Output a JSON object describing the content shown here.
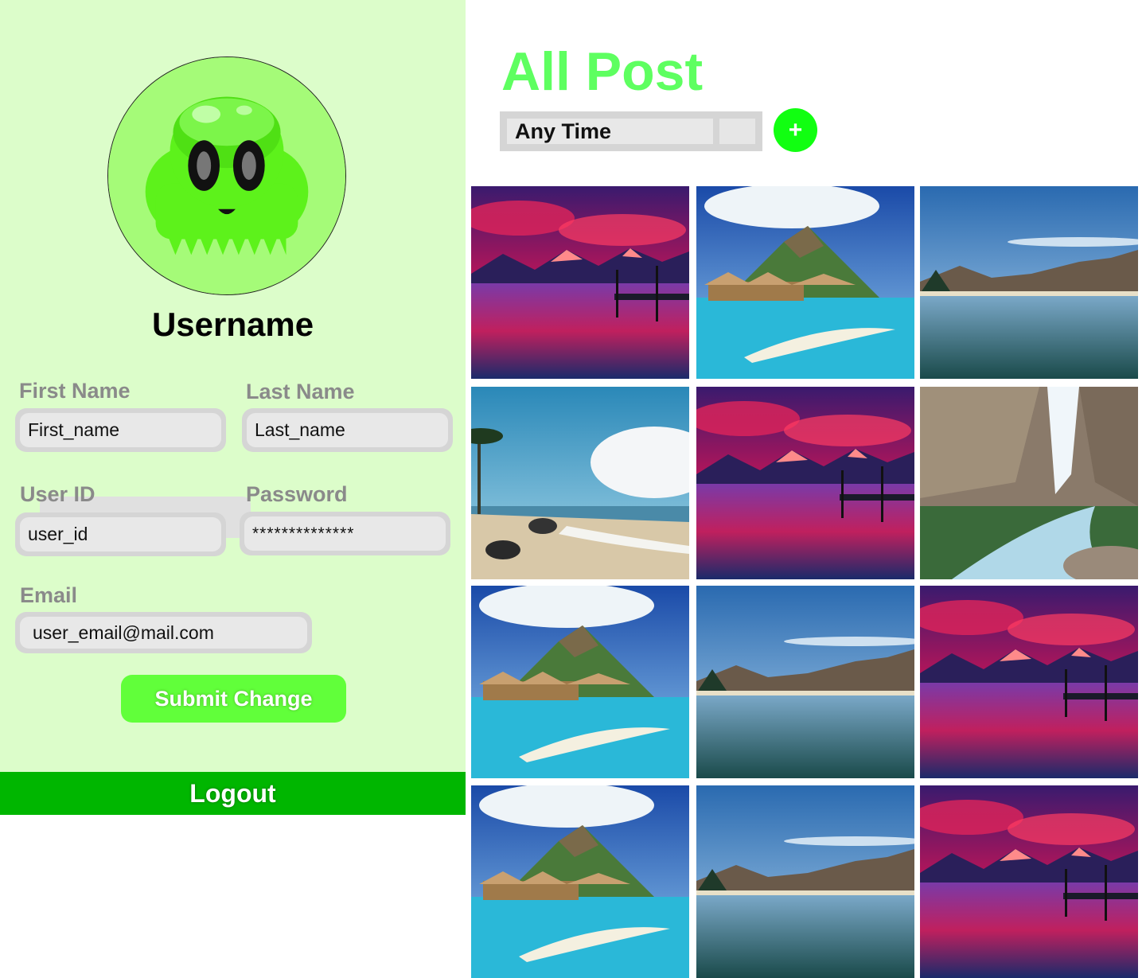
{
  "profile": {
    "username": "Username",
    "avatar_icon": "green-slime-alien-icon",
    "fields": {
      "first_name": {
        "label": "First Name",
        "value": "First_name"
      },
      "last_name": {
        "label": "Last Name",
        "value": "Last_name"
      },
      "user_id": {
        "label": "User ID",
        "value": "user_id"
      },
      "password": {
        "label": "Password",
        "value": "**************"
      },
      "email": {
        "label": "Email",
        "value": "user_email@mail.com"
      }
    },
    "submit_label": "Submit Change",
    "logout_label": "Logout"
  },
  "posts_section": {
    "title": "All Post",
    "time_filter": {
      "selected": "Any Time"
    },
    "add_button_label": "+"
  },
  "posts": [
    {
      "scene": "sunset-lake"
    },
    {
      "scene": "tropical-island"
    },
    {
      "scene": "mountain-lake"
    },
    {
      "scene": "beach"
    },
    {
      "scene": "sunset-lake"
    },
    {
      "scene": "waterfall"
    },
    {
      "scene": "tropical-island"
    },
    {
      "scene": "mountain-lake"
    },
    {
      "scene": "sunset-lake"
    },
    {
      "scene": "tropical-island"
    },
    {
      "scene": "mountain-lake"
    },
    {
      "scene": "sunset-lake"
    }
  ],
  "colors": {
    "sidebar_bg": "#dcfdca",
    "accent_green": "#5eff60",
    "submit_green": "#61ff3a",
    "logout_green": "#00b600",
    "add_button": "#11ff11"
  }
}
